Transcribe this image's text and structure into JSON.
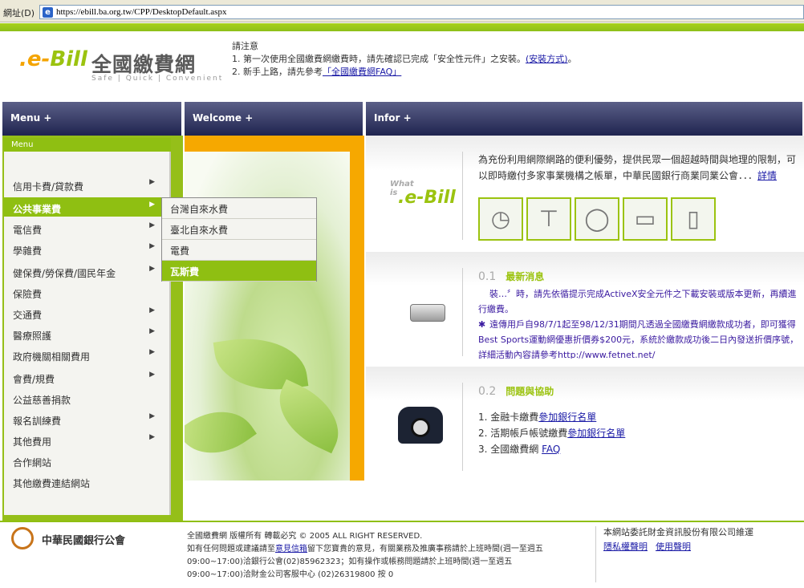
{
  "address_bar": {
    "label": "網址(D)",
    "url": "https://ebill.ba.org.tw/CPP/DesktopDefault.aspx"
  },
  "logo": {
    "e_prefix": ".e-",
    "bill": "Bill",
    "cn": "全國繳費網",
    "tagline": "Safe | Quick | Convenient"
  },
  "notice": {
    "title": "請注意",
    "line1": "1. 第一次使用全國繳費網繳費時，請先確認已完成「安全性元件」之安裝。",
    "line1_link": "(安裝方式)",
    "line1_end": "。",
    "line2": "2. 新手上路，請先參考",
    "line2_link": "「全國繳費網FAQ」"
  },
  "headers": {
    "menu": "Menu +",
    "welcome": "Welcome +",
    "infor": "Infor +"
  },
  "menu": {
    "title": "Menu",
    "items": [
      {
        "label": "信用卡費/貸款費",
        "arrow": "▶"
      },
      {
        "label": "公共事業費",
        "arrow": "▶"
      },
      {
        "label": "電信費",
        "arrow": "▶"
      },
      {
        "label": "學雜費",
        "arrow": "▶"
      },
      {
        "label": "健保費/勞保費/國民年金",
        "arrow": "▶"
      },
      {
        "label": "保險費",
        "arrow": ""
      },
      {
        "label": "交通費",
        "arrow": "▶"
      },
      {
        "label": "醫療照護",
        "arrow": "▶"
      },
      {
        "label": "政府機關相關費用",
        "arrow": "▶"
      },
      {
        "label": "會費/規費",
        "arrow": "▶"
      },
      {
        "label": "公益慈善捐款",
        "arrow": ""
      },
      {
        "label": "報名訓練費",
        "arrow": "▶"
      },
      {
        "label": "其他費用",
        "arrow": "▶"
      },
      {
        "label": "合作網站",
        "arrow": ""
      },
      {
        "label": "其他繳費連結網站",
        "arrow": ""
      }
    ],
    "submenu": [
      "台灣自來水費",
      "臺北自來水費",
      "電費",
      "瓦斯費"
    ]
  },
  "info": {
    "whatis_small": "What is",
    "whatis_big": ".e-Bill",
    "intro": "為充份利用網際網路的便利優勢，提供民眾一個超越時間與地理的限制，可以即時繳付多家事業機構之帳單，中華民國銀行商業同業公會．．．",
    "intro_link": "詳情",
    "thumbs": [
      "clock-icon",
      "faucet-icon",
      "bulb-icon",
      "card-icon",
      "phone-icon"
    ],
    "news_num": "0.1",
    "news_title": "最新消息",
    "news": [
      {
        "star": "",
        "text": "裝…〞時，請先依循提示完成ActiveX安全元件之下載安裝或版本更新，再續進行繳費。"
      },
      {
        "star": "✱",
        "text": "遠傳用戶自98/7/1起至98/12/31期間凡透過全國繳費網繳款成功者，即可獲得Best Sports運動網優惠折價券$200元，系統於繳款成功後二日內發送折價序號，詳細活動內容請參考http://www.fetnet.net/"
      }
    ],
    "help_num": "0.2",
    "help_title": "問題與協助",
    "help": [
      {
        "pre": "1. 金融卡繳費",
        "link": "參加銀行名單"
      },
      {
        "pre": "2. 活期帳戶帳號繳費",
        "link": "參加銀行名單"
      },
      {
        "pre": "3. 全國繳費網 ",
        "link": "FAQ"
      }
    ]
  },
  "footer": {
    "logo_text": "中華民國銀行公會",
    "copyright": "全國繳費網 版權所有 轉載必究 © 2005 ALL RIGHT RESERVED.",
    "contact_pre": "如有任何問題或建議請至",
    "contact_link": "意見信箱",
    "contact_post": "留下您寶貴的意見，有關業務及推廣事務請於上班時間(週一至週五 09:00~17:00)洽銀行公會(02)85962323；如有操作或帳務問題請於上班時間(週一至週五 09:00~17:00)洽財金公司客服中心 (02)26319800 按 0",
    "maintain": "本網站委託財金資訊股份有限公司維運",
    "privacy": "隱私權聲明",
    "terms": "使用聲明"
  },
  "colors": {
    "green": "#8fbf12",
    "orange": "#f6a800",
    "navy": "#2a2e58",
    "link": "#1a1aa6"
  }
}
